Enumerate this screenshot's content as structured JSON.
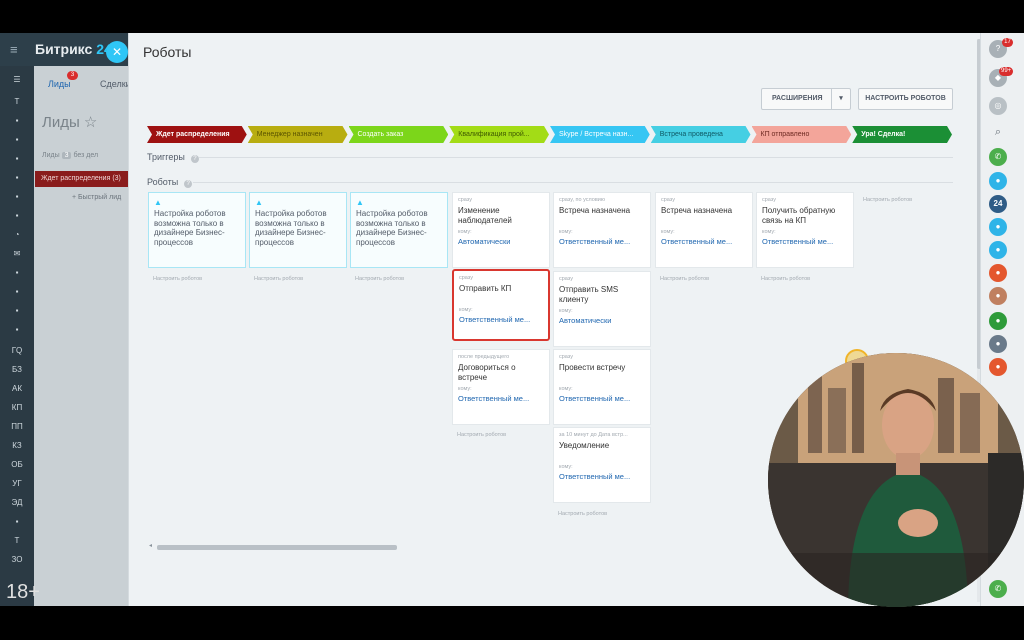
{
  "app": {
    "name": "Битрикс",
    "name_accent": "24"
  },
  "crm": {
    "tab_leads": "Лиды",
    "tab_leads_badge": "3",
    "tab_deals": "Сделки",
    "page_title": "Лиды",
    "stat_label": "Лиды",
    "stat_count": "3",
    "stat_suffix": "без дел",
    "stage_label": "Ждет распределения",
    "stage_count": "(3)",
    "quick_lead": "+ Быстрый лид"
  },
  "leftnav": [
    "Т",
    "",
    "",
    "",
    "",
    "",
    "",
    "",
    "",
    "",
    "",
    "",
    "",
    "",
    "",
    "ГQ",
    "БЗ",
    "АК",
    "КП",
    "ПП",
    "КЗ",
    "ОБ",
    "УГ",
    "ЭД",
    "",
    "Т",
    "ЗО"
  ],
  "age_badge": "18+",
  "slider": {
    "title": "Роботы",
    "extensions": "РАСШИРЕНИЯ",
    "setup": "НАСТРОИТЬ РОБОТОВ",
    "triggers": "Триггеры",
    "robots": "Роботы"
  },
  "stages": [
    {
      "label": "Ждет распределения",
      "color": "#9e1111",
      "text": "#ffffff"
    },
    {
      "label": "Менеджер назначен",
      "color": "#b8ad10",
      "text": "#5c5600"
    },
    {
      "label": "Создать заказ",
      "color": "#7cd61a",
      "text": "#ffffff"
    },
    {
      "label": "Квалификация прой...",
      "color": "#a3dc16",
      "text": "#3e5a00"
    },
    {
      "label": "Skype / Встреча назн...",
      "color": "#36c6f3",
      "text": "#ffffff"
    },
    {
      "label": "Встреча проведена",
      "color": "#45cfe3",
      "text": "#0f5a66"
    },
    {
      "label": "КП отправлено",
      "color": "#f3a59a",
      "text": "#6e2a22"
    },
    {
      "label": "Ура! Сделка!",
      "color": "#1b8f35",
      "text": "#ffffff"
    }
  ],
  "warning_text": "Настройка роботов возможна только в дизайнере Бизнес-процессов",
  "setup_link": "Настроить роботов",
  "cards": {
    "c4a": {
      "cond": "сразу",
      "name": "Изменение наблюдателей",
      "to": "кому:",
      "who": "Автоматически"
    },
    "c4b": {
      "cond": "сразу",
      "name": "Отправить КП",
      "to": "кому:",
      "who": "Ответственный ме..."
    },
    "c4c": {
      "cond": "после предыдущего",
      "name": "Договориться о встрече",
      "to": "кому:",
      "who": "Ответственный ме..."
    },
    "c5a": {
      "cond": "сразу, по условию",
      "name": "Встреча назначена",
      "to": "кому:",
      "who": "Ответственный ме..."
    },
    "c5b": {
      "cond": "сразу",
      "name": "Отправить SMS клиенту",
      "to": "кому:",
      "who": "Автоматически"
    },
    "c5c": {
      "cond": "сразу",
      "name": "Провести встречу",
      "to": "кому:",
      "who": "Ответственный ме..."
    },
    "c5d": {
      "cond": "за 10 минут до Дата встр...",
      "name": "Уведомление",
      "to": "кому:",
      "who": "Ответственный ме..."
    },
    "c6a": {
      "cond": "сразу",
      "name": "Встреча назначена",
      "to": "кому:",
      "who": "Ответственный ме..."
    },
    "c7a": {
      "cond": "сразу",
      "name": "Получить обратную связь на КП",
      "to": "кому:",
      "who": "Ответственный ме..."
    }
  },
  "rightbar": {
    "help_badge": "17",
    "bell_badge": "99+",
    "calendar_label": "24"
  }
}
